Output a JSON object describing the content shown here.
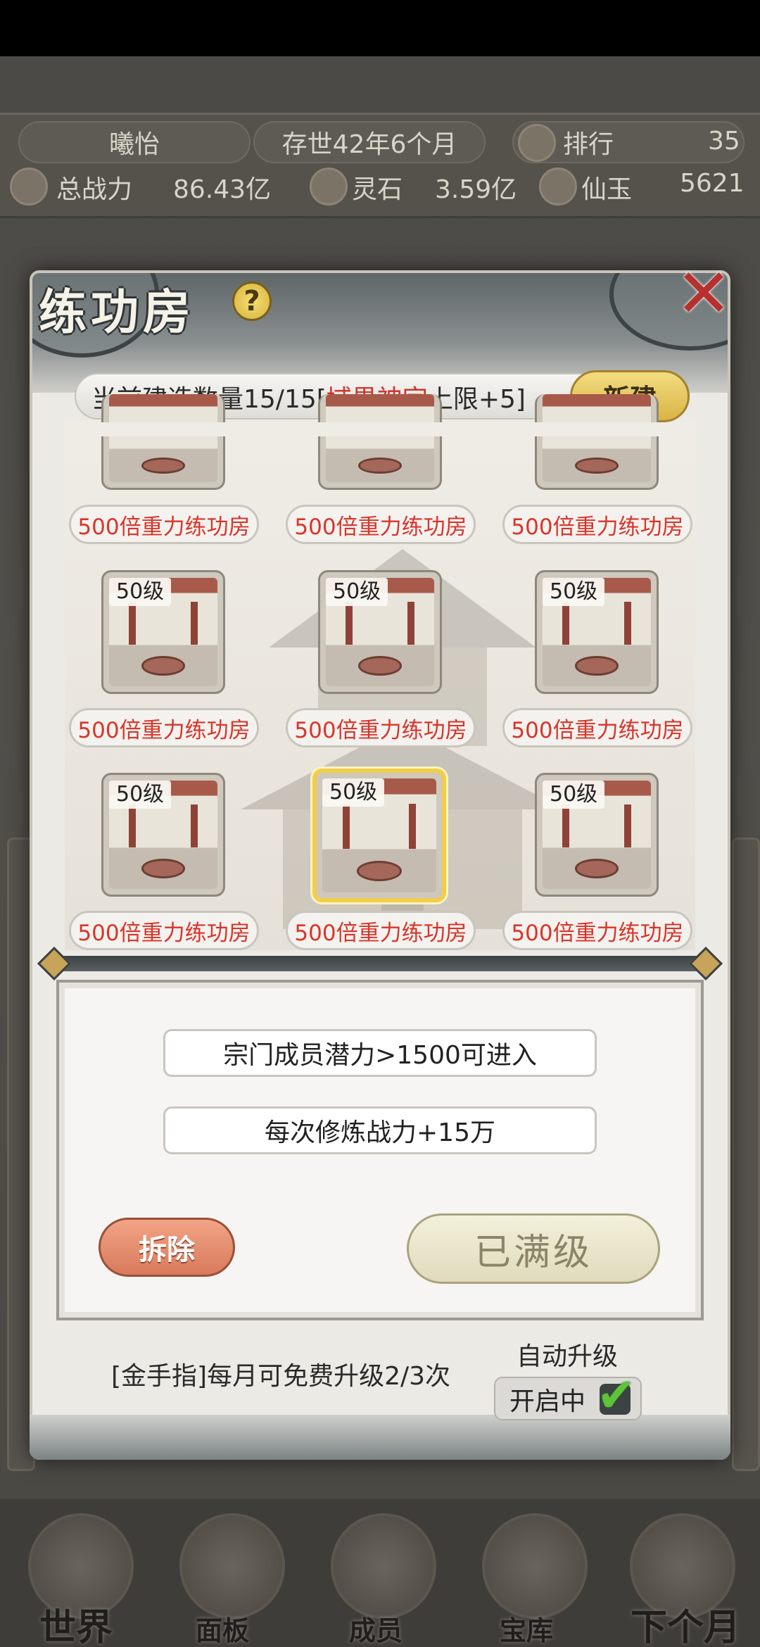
{
  "header": {
    "player_name": "曦怡",
    "age": "存世42年6个月",
    "rank_label": "排行",
    "rank_value": "35",
    "power_label": "总战力",
    "power_value": "86.43亿",
    "spirit_stone_label": "灵石",
    "spirit_stone_value": "3.59亿",
    "jade_label": "仙玉",
    "jade_value": "5621"
  },
  "modal": {
    "title": "练功房",
    "help_symbol": "?",
    "close_symbol": "✕",
    "count_prefix": "当前建造数量15/15[",
    "count_highlight": "域界神宗",
    "count_suffix": "上限+5]",
    "new_button": "新建",
    "rooms": [
      {
        "level": "",
        "name": "500倍重力练功房"
      },
      {
        "level": "",
        "name": "500倍重力练功房"
      },
      {
        "level": "",
        "name": "500倍重力练功房"
      },
      {
        "level": "50级",
        "name": "500倍重力练功房"
      },
      {
        "level": "50级",
        "name": "500倍重力练功房"
      },
      {
        "level": "50级",
        "name": "500倍重力练功房"
      },
      {
        "level": "50级",
        "name": "500倍重力练功房"
      },
      {
        "level": "50级",
        "name": "500倍重力练功房"
      },
      {
        "level": "50级",
        "name": "500倍重力练功房"
      }
    ],
    "info": {
      "requirement": "宗门成员潜力>1500可进入",
      "bonus": "每次修炼战力+15万"
    },
    "demolish_button": "拆除",
    "maxed_button": "已满级",
    "footer_note": "[金手指]每月可免费升级2/3次",
    "auto_upgrade_label": "自动升级",
    "auto_upgrade_state": "开启中"
  },
  "nav": {
    "world": "世界",
    "panel": "面板",
    "members": "成员",
    "treasury": "宝库",
    "next_month": "下个月"
  },
  "colors": {
    "accent_red": "#d8352c",
    "gold": "#f1cd4a",
    "check_green": "#5cc33b"
  }
}
